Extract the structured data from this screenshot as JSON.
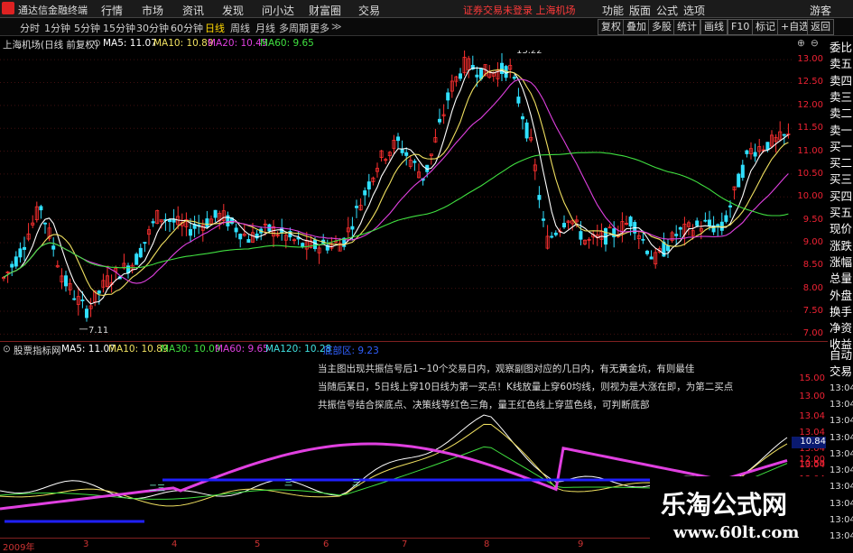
{
  "app": {
    "title": "通达信金融终端"
  },
  "menu": {
    "items": [
      "行情",
      "市场",
      "资讯",
      "发现",
      "问小达",
      "财富圈",
      "交易"
    ],
    "notice": "证券交易未登录 上海机场",
    "right": [
      "功能",
      "版面",
      "公式",
      "选项"
    ],
    "guest": "游客"
  },
  "toolbar": {
    "periods": [
      "分时",
      "1分钟",
      "5分钟",
      "15分钟",
      "30分钟",
      "60分钟",
      "日线",
      "周线",
      "月线",
      "多周期",
      "更多"
    ],
    "active_period": "日线",
    "right_buttons": [
      "复权",
      "叠加",
      "多股",
      "统计",
      "画线",
      "F10",
      "标记",
      "+自选",
      "返回"
    ]
  },
  "main": {
    "stock_label": "上海机场(日线 前复权)",
    "ma": [
      {
        "label": "MA5: 11.07",
        "color": "#ffffff"
      },
      {
        "label": "MA10: 10.89",
        "color": "#f0e060"
      },
      {
        "label": "MA20: 10.45",
        "color": "#e040e0"
      },
      {
        "label": "MA60: 9.65",
        "color": "#40e040"
      }
    ],
    "price_ticks": [
      "13.00",
      "12.50",
      "12.00",
      "11.50",
      "11.00",
      "10.50",
      "10.00",
      "9.50",
      "9.00",
      "8.50",
      "8.00",
      "7.50",
      "7.00"
    ],
    "high_label": "13.22",
    "low_label": "7.11"
  },
  "sub": {
    "title": "股票指标网",
    "ma": [
      {
        "label": "MA5: 11.07",
        "color": "#ffffff"
      },
      {
        "label": "MA10: 10.89",
        "color": "#f0e060"
      },
      {
        "label": "MA30: 10.09",
        "color": "#40e040"
      },
      {
        "label": "MA60: 9.65",
        "color": "#e040e0"
      },
      {
        "label": "MA120: 10.28",
        "color": "#40e0e0"
      },
      {
        "label": "底部区: 9.23",
        "color": "#3060ff"
      }
    ],
    "notes": [
      "当主图出现共振信号后1~10个交易日内，观察副图对应的几日内，有无黄金坑，有则最佳",
      "当随后某日，5日线上穿10日线为第一买点！K线放量上穿60均线，则视为是大涨在即，为第二买点",
      "共振信号结合探底点、决策线等红色三角，量王红色线上穿蓝色线，可判断底部"
    ],
    "ticks": [
      "15.00",
      "13.00",
      "13.04",
      "13.04",
      "13.04",
      "13.04",
      "12.00",
      "13.04",
      "10.50",
      "13.04",
      "13.04"
    ],
    "highlight": "10.84",
    "mark_labels": [
      "二三",
      "三",
      "三"
    ]
  },
  "xaxis": {
    "labels": [
      "2009年",
      "3",
      "4",
      "5",
      "6",
      "7",
      "8",
      "9"
    ]
  },
  "sidebar": {
    "items": [
      "委比",
      "卖五",
      "卖四",
      "卖三",
      "卖二",
      "卖一",
      "买一",
      "买二",
      "买三",
      "买四",
      "买五",
      "现价",
      "涨跌",
      "涨幅",
      "总量",
      "外盘",
      "换手",
      "净资",
      "收益",
      "自动",
      "交易",
      "13:04",
      "13:04",
      "13:04",
      "13:04",
      "13:04",
      "13:04",
      "13:04",
      "13:04",
      "13:04",
      "13:04"
    ]
  },
  "watermark": {
    "title": "乐淘公式网",
    "url": "www.60lt.com"
  },
  "colors": {
    "up": "#ff3030",
    "down": "#30e0ff",
    "axis": "#e02020",
    "blueline": "#2020ff"
  }
}
